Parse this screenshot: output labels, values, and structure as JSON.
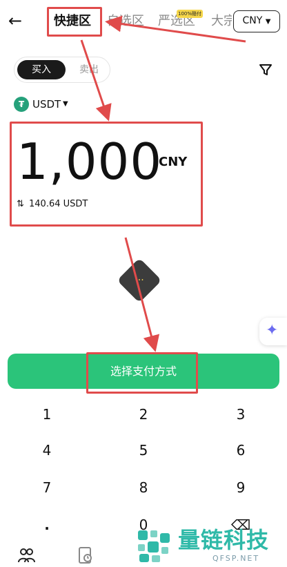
{
  "header": {
    "back_icon": "arrow-left-icon",
    "tabs": [
      {
        "label": "快捷区",
        "active": true
      },
      {
        "label": "自选区",
        "active": false
      },
      {
        "label": "严选区",
        "active": false
      },
      {
        "label": "大宗区",
        "active": false
      }
    ],
    "tab_badge": "100%赔付",
    "currency": "CNY"
  },
  "trade_mode": {
    "buy": "买入",
    "sell": "卖出",
    "selected": "buy"
  },
  "filter_icon": "filter-icon",
  "crypto": {
    "icon": "tether-icon",
    "symbol": "USDT"
  },
  "amount": {
    "value": "1,000",
    "unit": "CNY",
    "converted": "140.64 USDT",
    "swap_icon": "swap-arrows-icon"
  },
  "action_button": "选择支付方式",
  "keypad": [
    "1",
    "2",
    "3",
    "4",
    "5",
    "6",
    "7",
    "8",
    "9",
    ".",
    "0",
    "⌫"
  ],
  "bottom_nav": {
    "icons": [
      "users-icon",
      "orders-clock-icon"
    ]
  },
  "watermark": {
    "text": "量链科技",
    "sub": "QFSP.NET"
  },
  "colors": {
    "accent_green": "#2bc47a",
    "annotation_red": "#e04b4b",
    "tether_green": "#26a17b"
  }
}
